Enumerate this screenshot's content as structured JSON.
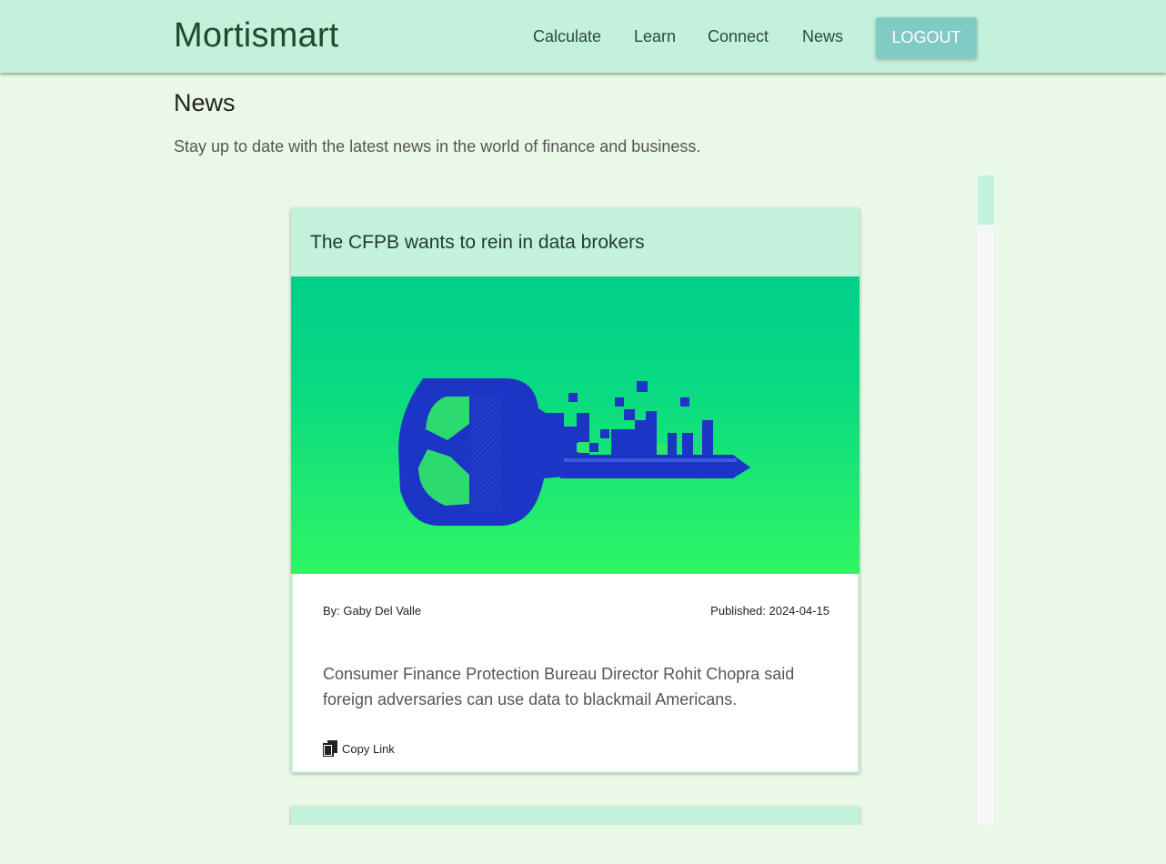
{
  "app": {
    "brand": "Mortismart"
  },
  "nav": {
    "links": [
      "Calculate",
      "Learn",
      "Connect",
      "News"
    ],
    "logout_label": "LOGOUT"
  },
  "page": {
    "title": "News",
    "subtitle": "Stay up to date with the latest news in the world of finance and business."
  },
  "articles": [
    {
      "title": "The CFPB wants to rein in data brokers",
      "image_icon": "pixelated-key-image",
      "author": "By: Gaby Del Valle",
      "published": "Published: 2024-04-15",
      "summary": "Consumer Finance Protection Bureau Director Rohit Chopra said foreign adversaries can use data to blackmail Americans.",
      "copy_label": "Copy Link"
    }
  ],
  "colors": {
    "header_bg": "#c4f1dc",
    "page_bg": "#eaf8e7",
    "button_bg": "#80cbc4",
    "image_gradient_top": "#00d08a",
    "image_gradient_bottom": "#2ef564",
    "key_blue": "#1d35c4"
  }
}
